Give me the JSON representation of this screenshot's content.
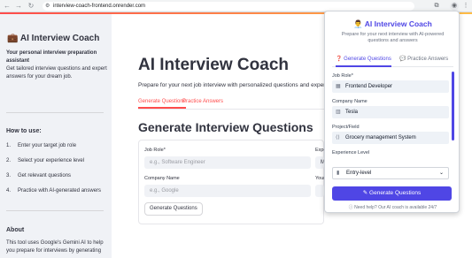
{
  "browser": {
    "url": "interview-coach-frontend.onrender.com"
  },
  "sidebar": {
    "title": "AI Interview Coach",
    "subtitle": "Your personal interview preparation assistant",
    "description": "Get tailored interview questions and expert answers for your dream job.",
    "how_to_title": "How to use:",
    "steps": [
      {
        "num": "1.",
        "text": "Enter your target job role"
      },
      {
        "num": "2.",
        "text": "Select your experience level"
      },
      {
        "num": "3.",
        "text": "Get relevant questions"
      },
      {
        "num": "4.",
        "text": "Practice with AI-generated answers"
      }
    ],
    "about_title": "About",
    "about_text": "This tool uses Google's Gemini AI to help you prepare for interviews by generating"
  },
  "main": {
    "title": "AI Interview Coach",
    "subtitle": "Prepare for your next job interview with personalized questions and expert-crafted",
    "tabs": [
      "Generate Questions",
      "Practice Answers"
    ],
    "section_title": "Generate Interview Questions",
    "form": {
      "job_role_label": "Job Role*",
      "job_role_placeholder": "e.g., Software Engineer",
      "exp_label": "Expe",
      "exp_value": "M",
      "company_label": "Company Name",
      "company_placeholder": "e.g., Google",
      "your_label": "Your",
      "submit_label": "Generate Questions"
    }
  },
  "popup": {
    "title": "AI Interview Coach",
    "description": "Prepare for your next interview with AI-powered questions and answers",
    "tabs": [
      "Generate Questions",
      "Practice Answers"
    ],
    "job_role_label": "Job Role*",
    "job_role_value": "Frontend Developer",
    "company_label": "Company Name",
    "company_value": "Tesla",
    "project_label": "Project/Field",
    "project_value": "Grocery management System",
    "experience_label": "Experience Level",
    "experience_value": "Entry-level",
    "button_label": "Generate Questions",
    "help_text": "Need help? Our AI coach is available 24/7"
  },
  "colors": {
    "accent_red": "#ff4b4b",
    "popup_accent": "#4f46e5",
    "sidebar_bg": "#f0f2f6"
  }
}
